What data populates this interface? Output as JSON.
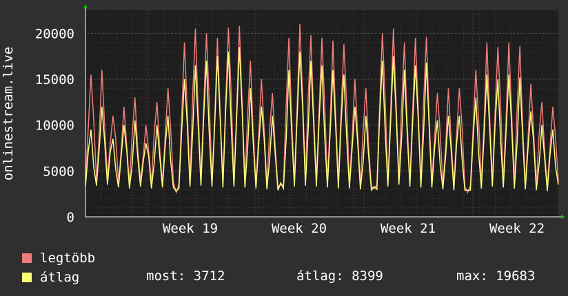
{
  "chart_data": {
    "type": "line",
    "ylabel": "onlinestream.live",
    "ylim": [
      0,
      22500
    ],
    "yticks": [
      0,
      5000,
      10000,
      15000,
      20000
    ],
    "ytick_labels": [
      "0",
      "5000",
      "10000",
      "15000",
      "20000"
    ],
    "xticks": [
      "Week 19",
      "Week 20",
      "Week 21",
      "Week 22"
    ],
    "grid": true,
    "colors": {
      "background": "#2f2f2f",
      "plot_bg": "#1e1e1e",
      "grid": "#444444",
      "week_line": "#6b2b2b",
      "axis": "#ffffff",
      "max_series": "#f07d7d",
      "avg_series": "#ffff7a"
    },
    "series": [
      {
        "name": "legtöbb",
        "color": "#f07d7d",
        "daily": [
          [
            3800,
            15500,
            4000,
            16000,
            4200,
            11000,
            3800,
            12000,
            3600,
            13000,
            3900,
            10000,
            3600,
            12500,
            3700,
            14000,
            3800
          ],
          [
            3600,
            19000,
            3800,
            20500,
            4000,
            20000,
            3900,
            19500,
            3800,
            20600,
            4000,
            20800,
            3800,
            17000,
            3600,
            15000,
            3400,
            13500,
            3300
          ],
          [
            3600,
            19500,
            3900,
            21000,
            4100,
            19800,
            4000,
            19500,
            3800,
            19200,
            3700,
            18800,
            3600,
            15000,
            3400,
            14000,
            3300
          ],
          [
            3500,
            20000,
            3900,
            20500,
            4200,
            19000,
            3900,
            19500,
            3700,
            19600,
            3800,
            13500,
            3500,
            14000,
            3400,
            14000,
            3300
          ],
          [
            3400,
            16000,
            3700,
            19000,
            3900,
            18500,
            3800,
            19000,
            3700,
            18600,
            3500,
            14500,
            3400,
            12500,
            3300,
            12000,
            3800
          ]
        ]
      },
      {
        "name": "átlag",
        "color": "#ffff7a",
        "daily": [
          [
            3300,
            9500,
            3400,
            12000,
            3500,
            8500,
            3200,
            10000,
            3100,
            10500,
            3300,
            8000,
            3100,
            10000,
            3200,
            11000,
            3200
          ],
          [
            3100,
            15000,
            3300,
            16500,
            3400,
            17000,
            3300,
            17500,
            3200,
            18000,
            3300,
            18500,
            3200,
            14000,
            3100,
            12000,
            3000,
            11000,
            2900
          ],
          [
            3100,
            16000,
            3300,
            18000,
            3400,
            17000,
            3300,
            16500,
            3200,
            16000,
            3100,
            15500,
            3100,
            12000,
            3000,
            11000,
            2900
          ],
          [
            3000,
            17000,
            3300,
            17500,
            3500,
            16000,
            3300,
            16500,
            3200,
            16800,
            3200,
            10500,
            3000,
            11000,
            2900,
            11000,
            2900
          ],
          [
            2900,
            13000,
            3100,
            15500,
            3300,
            15000,
            3200,
            15500,
            3100,
            15200,
            3000,
            11500,
            2900,
            10000,
            2800,
            9500,
            3500
          ]
        ]
      }
    ]
  },
  "legend": {
    "items": [
      {
        "label": "legtöbb",
        "color": "#f07d7d"
      },
      {
        "label": "átlag",
        "color": "#ffff7a"
      }
    ],
    "stats": {
      "most": "most: 3712",
      "atlag": "átlag: 8399",
      "max": "max: 19683"
    }
  }
}
